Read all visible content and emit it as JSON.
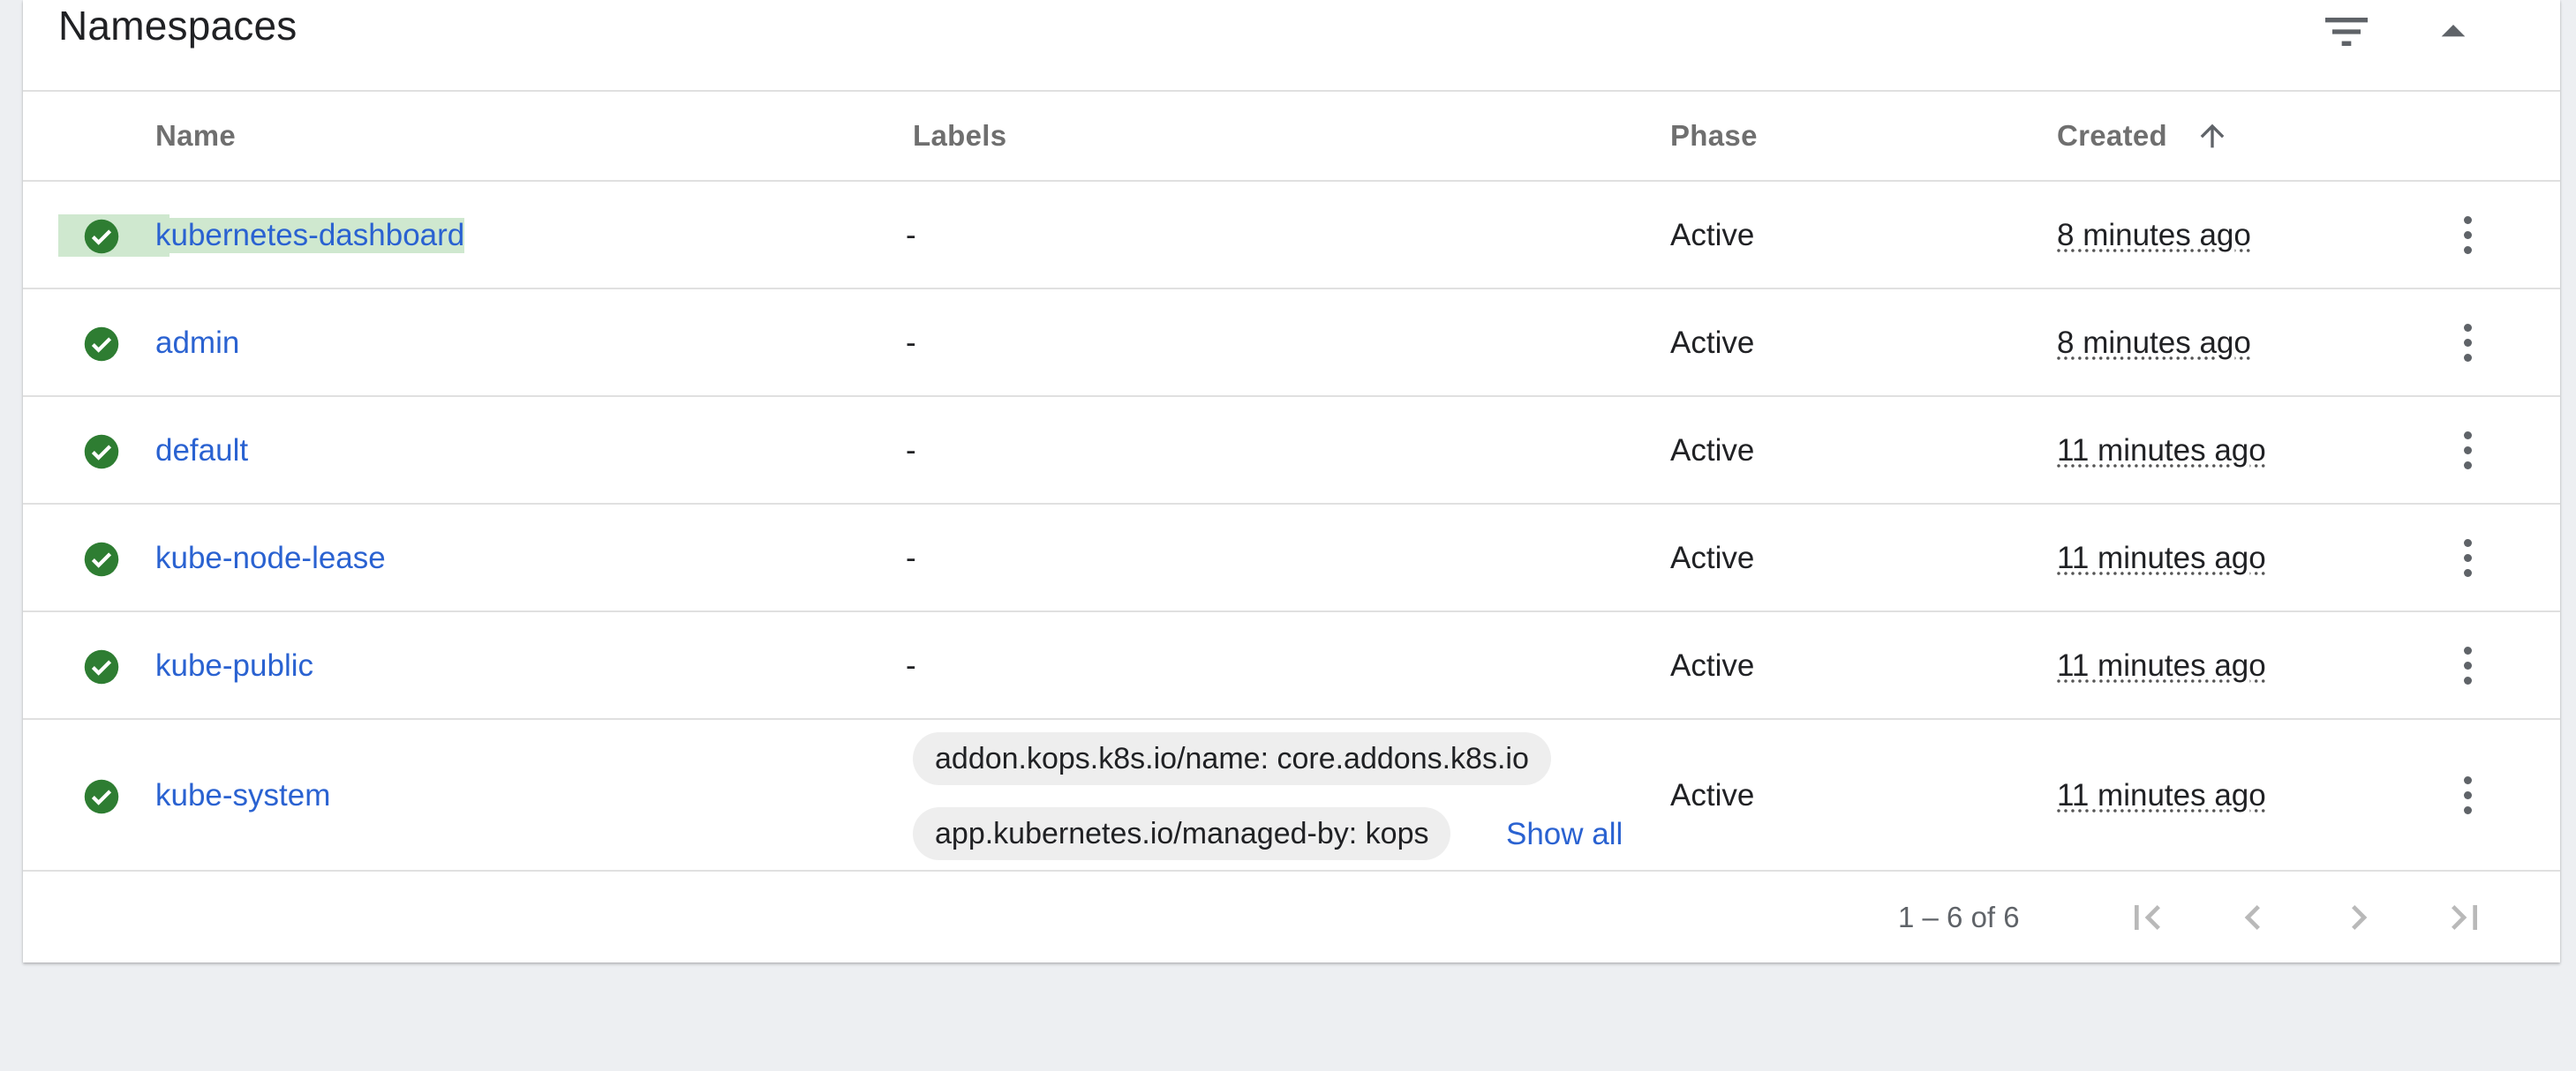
{
  "card": {
    "title": "Namespaces",
    "filter_icon": "filter-list-icon",
    "collapse_icon": "arrow-drop-up-icon"
  },
  "columns": {
    "name": "Name",
    "labels": "Labels",
    "phase": "Phase",
    "created": "Created",
    "sort": {
      "column": "Created",
      "direction": "ascending",
      "icon": "arrow-upward-icon"
    }
  },
  "rows": [
    {
      "status": "check-circle-icon",
      "name": "kubernetes-dashboard",
      "labels": "-",
      "phase": "Active",
      "created": "8 minutes ago",
      "selected": true
    },
    {
      "status": "check-circle-icon",
      "name": "admin",
      "labels": "-",
      "phase": "Active",
      "created": "8 minutes ago"
    },
    {
      "status": "check-circle-icon",
      "name": "default",
      "labels": "-",
      "phase": "Active",
      "created": "11 minutes ago"
    },
    {
      "status": "check-circle-icon",
      "name": "kube-node-lease",
      "labels": "-",
      "phase": "Active",
      "created": "11 minutes ago"
    },
    {
      "status": "check-circle-icon",
      "name": "kube-public",
      "labels": "-",
      "phase": "Active",
      "created": "11 minutes ago"
    },
    {
      "status": "check-circle-icon",
      "name": "kube-system",
      "labels": [
        "addon.kops.k8s.io/name: core.addons.k8s.io",
        "app.kubernetes.io/managed-by: kops"
      ],
      "show_all": "Show all",
      "phase": "Active",
      "created": "11 minutes ago"
    }
  ],
  "pagination": {
    "range": "1 – 6 of 6",
    "icons": [
      "first-page-icon",
      "chevron-left-icon",
      "chevron-right-icon",
      "last-page-icon"
    ]
  },
  "colors": {
    "status_ok": "#2e7d32",
    "link": "#2a62d1",
    "selection": "#cfe8cf",
    "page_background": "#edeff2"
  }
}
